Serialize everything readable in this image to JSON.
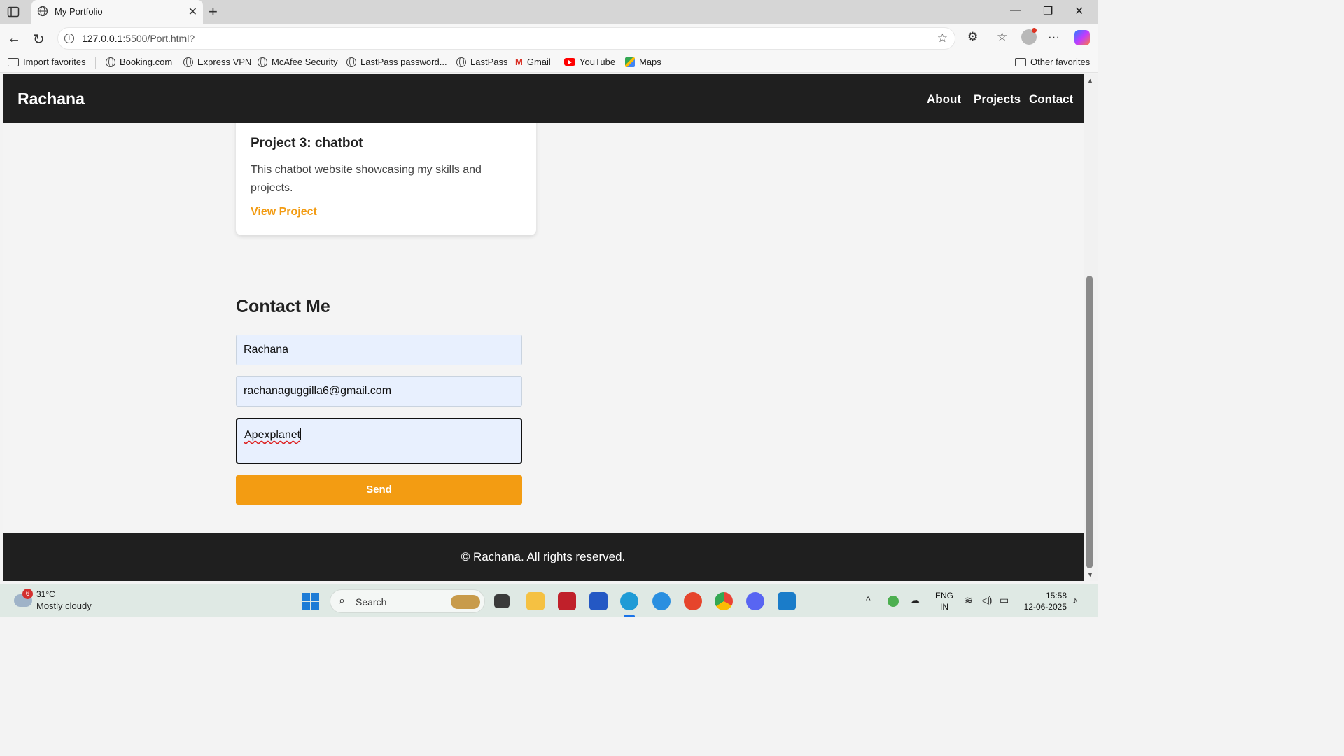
{
  "browser": {
    "tab_title": "My Portfolio",
    "url_host": "127.0.0.1",
    "url_path": ":5500/Port.html?",
    "favorites": [
      {
        "label": "Import favorites",
        "icon": "import-icon"
      },
      {
        "label": "Booking.com",
        "icon": "globe-icon"
      },
      {
        "label": "Express VPN",
        "icon": "globe-icon"
      },
      {
        "label": "McAfee Security",
        "icon": "globe-icon"
      },
      {
        "label": "LastPass password...",
        "icon": "globe-icon"
      },
      {
        "label": "LastPass",
        "icon": "globe-icon"
      },
      {
        "label": "Gmail",
        "icon": "gmail-icon"
      },
      {
        "label": "YouTube",
        "icon": "youtube-icon"
      },
      {
        "label": "Maps",
        "icon": "maps-icon"
      }
    ],
    "other_favorites": "Other favorites"
  },
  "site": {
    "brand": "Rachana",
    "nav": [
      "About",
      "Projects",
      "Contact"
    ],
    "project": {
      "title": "Project 3: chatbot",
      "description": "This chatbot website showcasing my skills and projects.",
      "link": "View Project"
    },
    "contact": {
      "heading": "Contact Me",
      "name_value": "Rachana",
      "email_value": "rachanaguggilla6@gmail.com",
      "message_value": "Apexplanet",
      "send_label": "Send"
    },
    "footer": "© Rachana. All rights reserved.",
    "accent_color": "#f39c12",
    "header_color": "#1f1f1f"
  },
  "taskbar": {
    "weather_badge": "6",
    "temperature": "31°C",
    "weather_desc": "Mostly cloudy",
    "search_label": "Search",
    "lang_line1": "ENG",
    "lang_line2": "IN",
    "time": "15:58",
    "date": "12-06-2025"
  }
}
